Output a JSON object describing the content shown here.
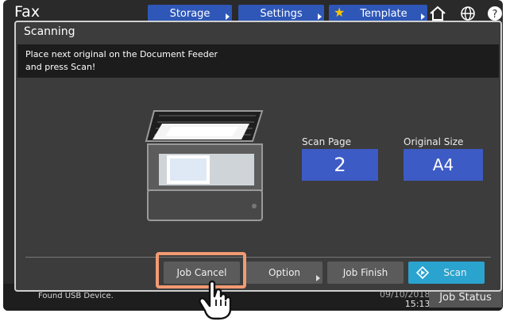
{
  "app": {
    "title": "Fax"
  },
  "top_tabs": [
    {
      "label": "Storage"
    },
    {
      "label": "Settings"
    },
    {
      "label": "Template"
    }
  ],
  "icons": {
    "home": "home-icon",
    "globe": "globe-icon",
    "help": "help-icon",
    "star": "star-icon"
  },
  "dialog": {
    "title": "Scanning",
    "message_line1": "Place next original on the Document Feeder",
    "message_line2": "and press Scan!"
  },
  "scan_page": {
    "label": "Scan Page",
    "value": "2"
  },
  "original_size": {
    "label": "Original Size",
    "value": "A4"
  },
  "buttons": {
    "job_cancel": "Job Cancel",
    "option": "Option",
    "job_finish": "Job Finish",
    "scan": "Scan"
  },
  "status": {
    "message": "Found USB Device.",
    "date": "09/10/2018",
    "time": "15:13",
    "job_status": "Job Status"
  },
  "colors": {
    "accent_blue": "#3d5bc5",
    "scan_button": "#2aa3cf",
    "highlight": "#f19a73"
  }
}
